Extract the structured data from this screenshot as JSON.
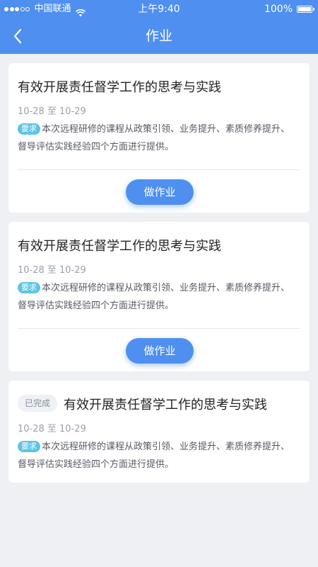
{
  "status_bar": {
    "carrier": "中国联通",
    "time": "上午9:40",
    "battery": "100%",
    "battery_level": 1.0
  },
  "nav": {
    "title": "作业",
    "back_icon": "chevron-left-icon"
  },
  "cards": [
    {
      "title": "有效开展责任督学工作的思考与实践",
      "dates": "10-28 至 10-29",
      "req_label": "要求",
      "desc": "本次远程研修的课程从政策引领、业务提升、素质修养提升、督导评估实践经验四个方面进行提供。",
      "button_label": "做作业"
    },
    {
      "title": "有效开展责任督学工作的思考与实践",
      "dates": "10-28 至 10-29",
      "req_label": "要求",
      "desc": "本次远程研修的课程从政策引领、业务提升、素质修养提升、督导评估实践经验四个方面进行提供。",
      "button_label": "做作业"
    },
    {
      "status": "已完成",
      "title": "有效开展责任督学工作的思考与实践",
      "dates": "10-28 至 10-29",
      "req_label": "要求",
      "desc": "本次远程研修的课程从政策引领、业务提升、素质修养提升、督导评估实践经验四个方面进行提供。"
    }
  ],
  "colors": {
    "header": "#4f8ff0",
    "badge": "#5cc4e6",
    "background": "#eef0f3"
  }
}
